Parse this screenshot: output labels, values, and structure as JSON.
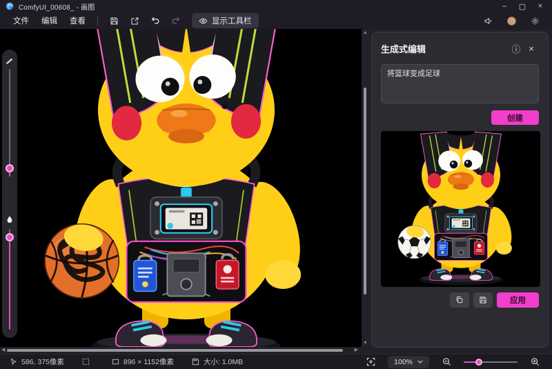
{
  "window": {
    "title": "ComfyUI_00608_ - 画图",
    "controls": {
      "minimize": "–",
      "maximize": "▢",
      "close": "×"
    }
  },
  "menu_bar": {
    "items": [
      {
        "label": "文件"
      },
      {
        "label": "编辑"
      },
      {
        "label": "查看"
      }
    ],
    "icon_buttons": [
      "save-icon",
      "share-icon",
      "undo-icon",
      "redo-icon"
    ],
    "show_toolbar_label": "显示工具栏",
    "right_icons": [
      "feedback-megaphone-icon",
      "account-avatar",
      "settings-gear-icon"
    ]
  },
  "right_panel": {
    "title": "生成式编辑",
    "header_icons": [
      "info-icon",
      "close-icon"
    ],
    "info_glyph": "ⓘ",
    "close_glyph": "×",
    "prompt_value": "将篮球变成足球",
    "create_label": "创建",
    "apply_label": "应用",
    "action_icons": [
      "copy-icon",
      "save-image-icon"
    ]
  },
  "status_bar": {
    "items": [
      {
        "icon": "cursor-icon",
        "text": "586, 375像素"
      },
      {
        "icon": "selection-icon",
        "text": ""
      },
      {
        "icon": "canvas-size-icon",
        "text": "896 × 1152像素"
      },
      {
        "icon": "file-size-icon",
        "text": "大小: 1.0MB"
      }
    ],
    "zoom_level": "100%",
    "right_icons": [
      "fit-to-screen-icon",
      "zoom-out-icon",
      "zoom-in-icon"
    ]
  },
  "left_rail": {
    "sliders": [
      {
        "icon": "brush-size-icon",
        "value_position": "low"
      },
      {
        "icon": "opacity-drop-icon",
        "value_position": "high"
      }
    ]
  },
  "colors": {
    "accent_pink": "#f13ecb",
    "titlebar_bg": "#1f1c25",
    "panel_bg": "#2c2b31",
    "canvas_bg": "#000000",
    "figure": {
      "yellow": "#ffcf18",
      "yellow_light": "#ffd83a",
      "dark": "#1a1a1f",
      "neon_pink": "#ff5fd2",
      "neon_green": "#b8e03a",
      "cyan": "#2ec8e8",
      "cheek_red": "#e2293f",
      "beak_orange": "#ef7916",
      "ball_orange": "#e2702a"
    }
  },
  "illustration": {
    "main_canvas": {
      "subject": "cyberpunk-chick-figurine",
      "ball": "basketball",
      "scribble_annotation": true
    },
    "preview": {
      "subject": "cyberpunk-chick-figurine",
      "ball": "soccer",
      "scribble_annotation": false
    }
  }
}
